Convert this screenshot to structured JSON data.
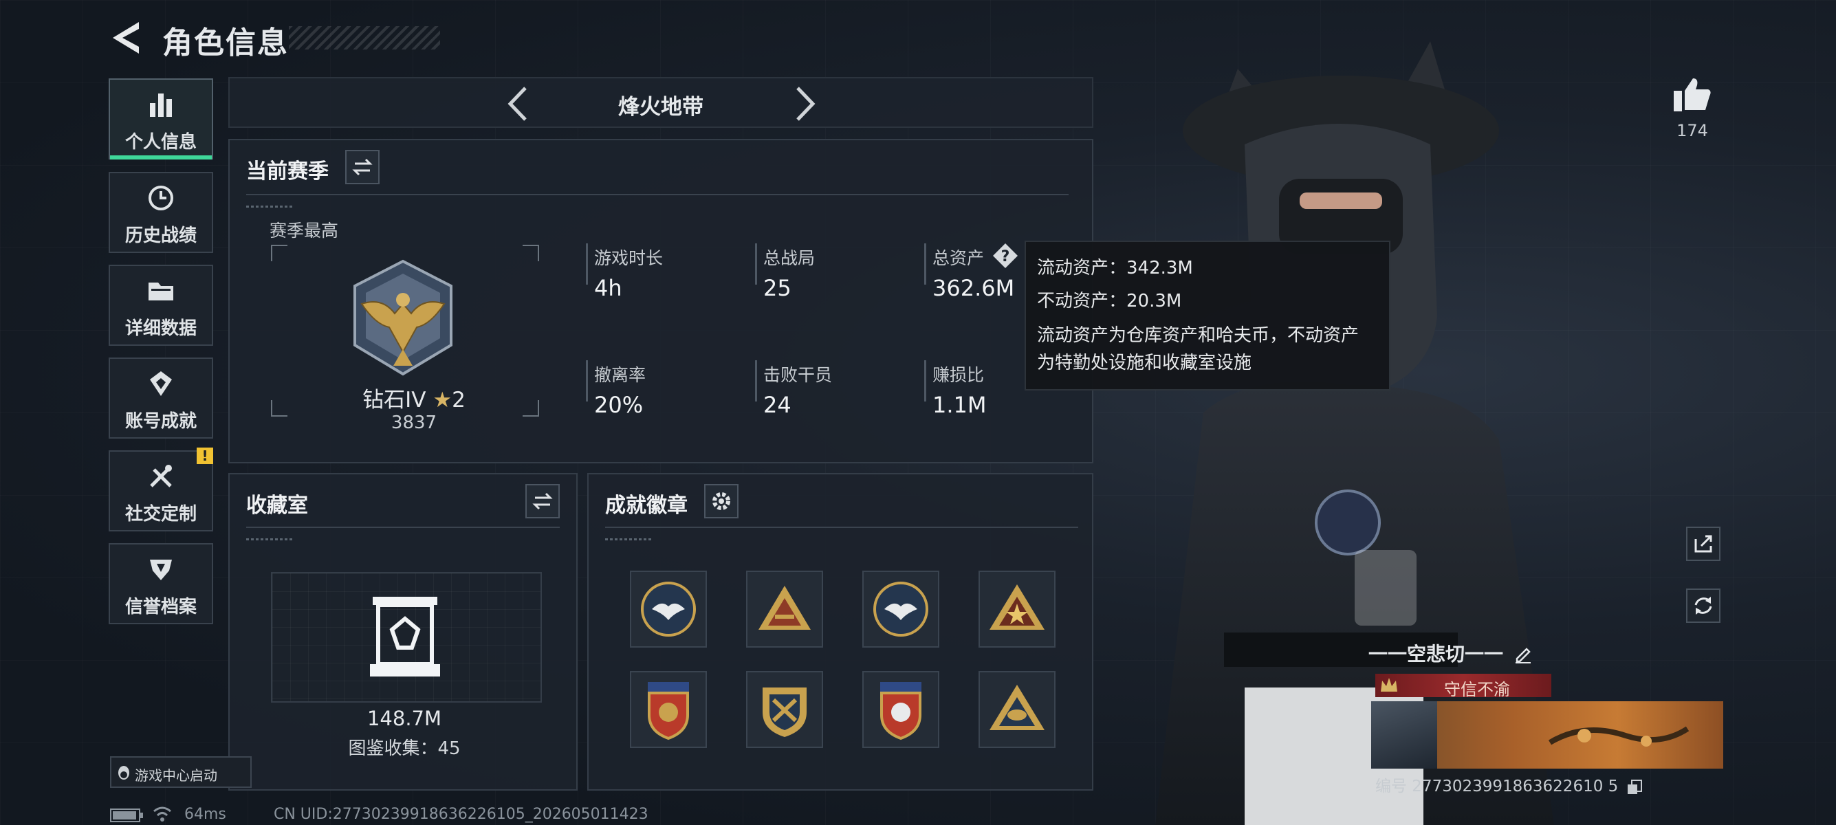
{
  "header": {
    "title": "角色信息"
  },
  "sidebar": {
    "items": [
      {
        "label": "个人信息"
      },
      {
        "label": "历史战绩"
      },
      {
        "label": "详细数据"
      },
      {
        "label": "账号成就"
      },
      {
        "label": "社交定制",
        "badge": "!"
      },
      {
        "label": "信誉档案"
      }
    ]
  },
  "mode_selector": {
    "label": "烽火地带"
  },
  "season": {
    "title": "当前赛季",
    "best_label": "赛季最高",
    "rank_name": "钻石IV",
    "rank_stars": "2",
    "rank_score": "3837",
    "stats": [
      {
        "label": "游戏时长",
        "value": "4h"
      },
      {
        "label": "总战局",
        "value": "25"
      },
      {
        "label": "总资产",
        "value": "362.6M"
      },
      {
        "label": "撤离率",
        "value": "20%"
      },
      {
        "label": "击败干员",
        "value": "24"
      },
      {
        "label": "赚损比",
        "value": "1.1M"
      }
    ]
  },
  "tooltip": {
    "line1": "流动资产：342.3M",
    "line2": "不动资产：20.3M",
    "desc1": "流动资产为仓库资产和哈夫币，不动资产",
    "desc2": "为特勤处设施和收藏室设施"
  },
  "collection": {
    "title": "收藏室",
    "value": "148.7M",
    "catalog": "图鉴收集：45"
  },
  "achievements": {
    "title": "成就徽章",
    "badges": [
      "eagle-blue",
      "triangle-gold",
      "eagle-blue",
      "triangle-star",
      "shield-red",
      "shield-gold",
      "shield-red",
      "triangle-eye"
    ]
  },
  "likes": {
    "count": "174"
  },
  "player": {
    "name": "一一空悲切一一",
    "title": "守信不渝",
    "id_line": "编号 2773023991863622610 5"
  },
  "footer": {
    "launcher": "游戏中心启动",
    "ping": "64ms",
    "uid": "CN UID:27730239918636226105_202605011423"
  },
  "colors": {
    "accent": "#3fd89a",
    "tooltip_bg": "#141619",
    "title_red": "#8e1f22",
    "warn": "#f1c232"
  }
}
